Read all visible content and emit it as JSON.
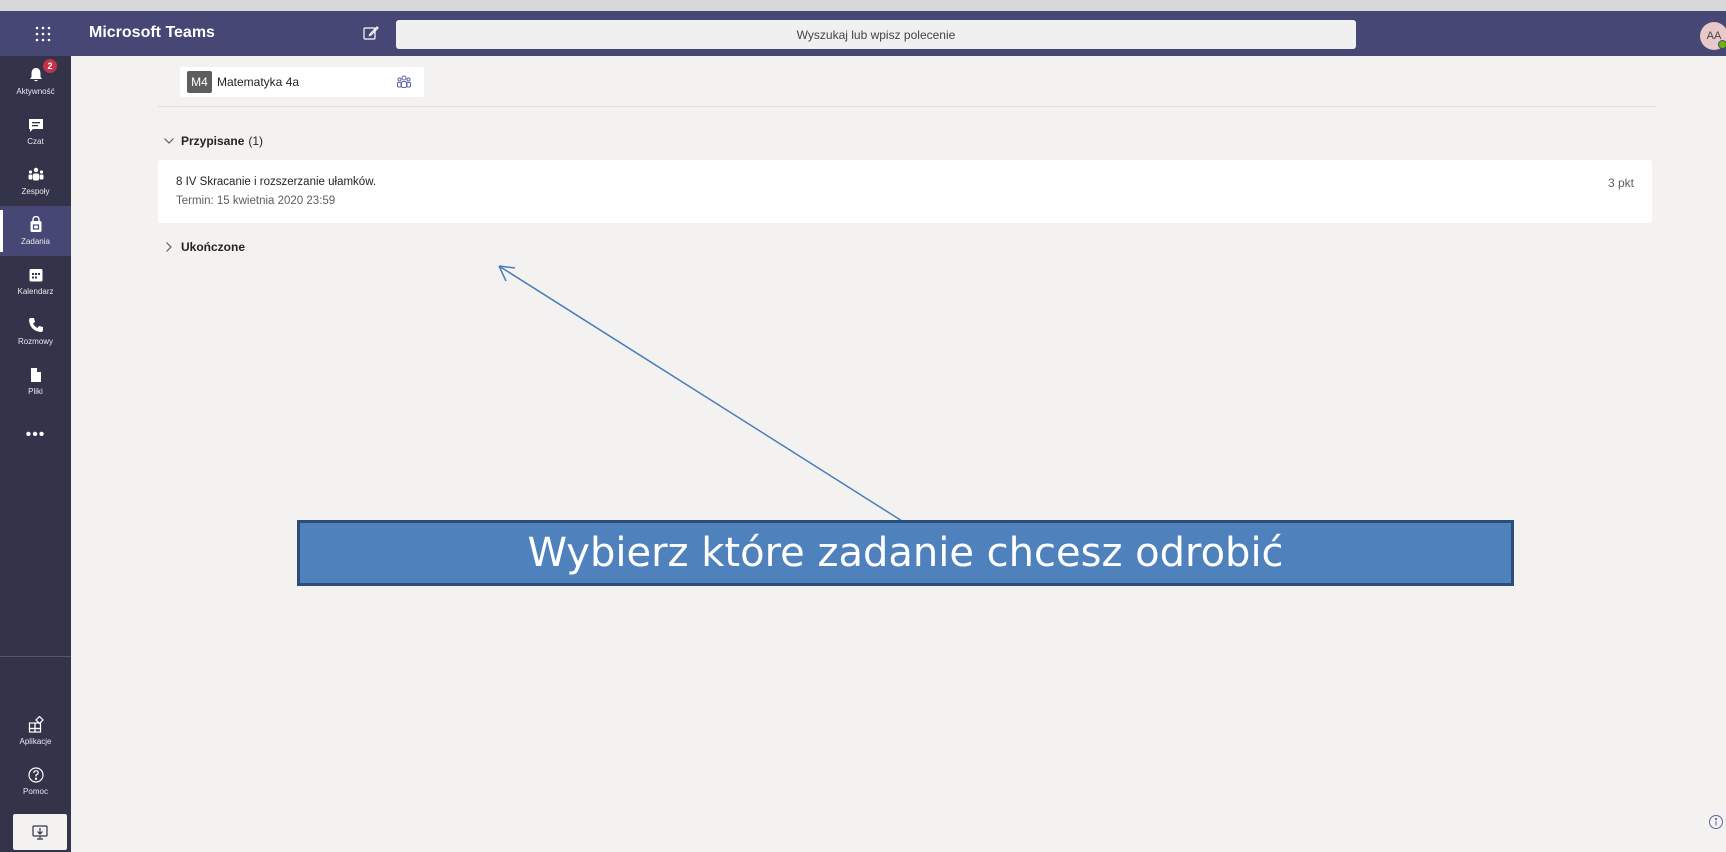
{
  "header": {
    "app_title": "Microsoft Teams",
    "search_placeholder": "Wyszukaj lub wpisz polecenie",
    "avatar_initials": "AA"
  },
  "rail": {
    "items": [
      {
        "label": "Aktywność",
        "icon": "bell-icon",
        "badge": "2"
      },
      {
        "label": "Czat",
        "icon": "chat-icon"
      },
      {
        "label": "Zespoły",
        "icon": "teams-icon"
      },
      {
        "label": "Zadania",
        "icon": "assignments-icon",
        "active": true
      },
      {
        "label": "Kalendarz",
        "icon": "calendar-icon"
      },
      {
        "label": "Rozmowy",
        "icon": "phone-icon"
      },
      {
        "label": "Pliki",
        "icon": "files-icon"
      }
    ],
    "more": "•••",
    "bottom_items": [
      {
        "label": "Aplikacje",
        "icon": "apps-icon"
      },
      {
        "label": "Pomoc",
        "icon": "help-icon"
      }
    ]
  },
  "class": {
    "tile": "M4",
    "name": "Matematyka 4a"
  },
  "sections": {
    "assigned": {
      "label": "Przypisane",
      "count": "(1)"
    },
    "completed": {
      "label": "Ukończone"
    }
  },
  "task": {
    "title": "8 IV Skracanie i rozszerzanie ułamków.",
    "due": "Termin: 15 kwietnia 2020 23:59",
    "points": "3 pkt"
  },
  "annotation": {
    "text": "Wybierz które zadanie chcesz odrobić"
  },
  "colors": {
    "titlebar": "#464775",
    "rail": "#33344a",
    "accent": "#6264a7",
    "annotation_box": "#4f81bd",
    "badge": "#c4314b"
  }
}
